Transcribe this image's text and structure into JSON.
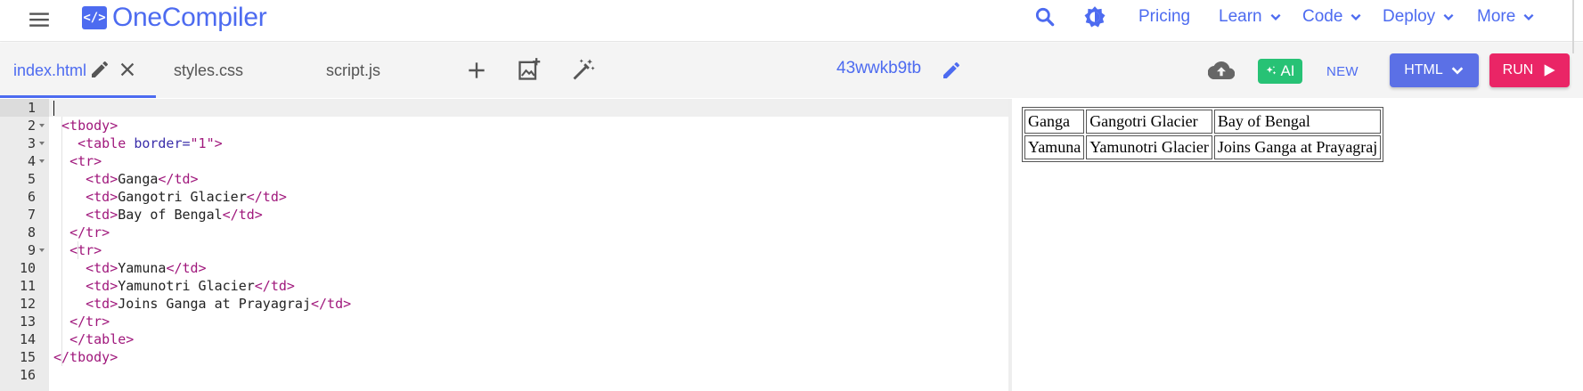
{
  "header": {
    "logo_mark": "</>",
    "brand": "OneCompiler",
    "nav": [
      {
        "label": "Pricing",
        "dropdown": false
      },
      {
        "label": "Learn",
        "dropdown": true
      },
      {
        "label": "Code",
        "dropdown": true
      },
      {
        "label": "Deploy",
        "dropdown": true
      },
      {
        "label": "More",
        "dropdown": true
      }
    ]
  },
  "tabs": [
    {
      "label": "index.html",
      "active": true
    },
    {
      "label": "styles.css",
      "active": false
    },
    {
      "label": "script.js",
      "active": false
    }
  ],
  "project": {
    "name": "43wwkb9tb"
  },
  "toolbar": {
    "ai_label": "AI",
    "new_label": "NEW",
    "language_label": "HTML",
    "run_label": "RUN"
  },
  "editor": {
    "lines": [
      {
        "n": "1",
        "fold": false,
        "html": ""
      },
      {
        "n": "2",
        "fold": true,
        "html": " <span class=\"tag\">&lt;tbody&gt;</span>"
      },
      {
        "n": "3",
        "fold": true,
        "html": "   <span class=\"tag\">&lt;table</span> <span class=\"attr\">border=</span><span class=\"str\">\"1\"</span><span class=\"tag\">&gt;</span>"
      },
      {
        "n": "4",
        "fold": true,
        "html": "  <span class=\"tag\">&lt;tr&gt;</span>"
      },
      {
        "n": "5",
        "fold": false,
        "html": "    <span class=\"tag\">&lt;td&gt;</span>Ganga<span class=\"tag\">&lt;/td&gt;</span>"
      },
      {
        "n": "6",
        "fold": false,
        "html": "    <span class=\"tag\">&lt;td&gt;</span>Gangotri Glacier<span class=\"tag\">&lt;/td&gt;</span>"
      },
      {
        "n": "7",
        "fold": false,
        "html": "    <span class=\"tag\">&lt;td&gt;</span>Bay of Bengal<span class=\"tag\">&lt;/td&gt;</span>"
      },
      {
        "n": "8",
        "fold": false,
        "html": "  <span class=\"tag\">&lt;/tr&gt;</span>"
      },
      {
        "n": "9",
        "fold": true,
        "html": "  <span class=\"tag\">&lt;tr&gt;</span>"
      },
      {
        "n": "10",
        "fold": false,
        "html": "    <span class=\"tag\">&lt;td&gt;</span>Yamuna<span class=\"tag\">&lt;/td&gt;</span>"
      },
      {
        "n": "11",
        "fold": false,
        "html": "    <span class=\"tag\">&lt;td&gt;</span>Yamunotri Glacier<span class=\"tag\">&lt;/td&gt;</span>"
      },
      {
        "n": "12",
        "fold": false,
        "html": "    <span class=\"tag\">&lt;td&gt;</span>Joins Ganga at Prayagraj<span class=\"tag\">&lt;/td&gt;</span>"
      },
      {
        "n": "13",
        "fold": false,
        "html": "  <span class=\"tag\">&lt;/tr&gt;</span>"
      },
      {
        "n": "14",
        "fold": false,
        "html": "  <span class=\"tag\">&lt;/table&gt;</span>"
      },
      {
        "n": "15",
        "fold": false,
        "html": "<span class=\"tag\">&lt;/tbody&gt;</span>"
      },
      {
        "n": "16",
        "fold": false,
        "html": ""
      }
    ]
  },
  "preview": {
    "rows": [
      [
        "Ganga",
        "Gangotri Glacier",
        "Bay of Bengal"
      ],
      [
        "Yamuna",
        "Yamunotri Glacier",
        "Joins Ganga at Prayagraj"
      ]
    ]
  },
  "colors": {
    "brand": "#4d6bf0",
    "ai_badge": "#27c275",
    "language_button": "#5b70e6",
    "run_button": "#ea2566",
    "tag_token": "#a0187c"
  }
}
